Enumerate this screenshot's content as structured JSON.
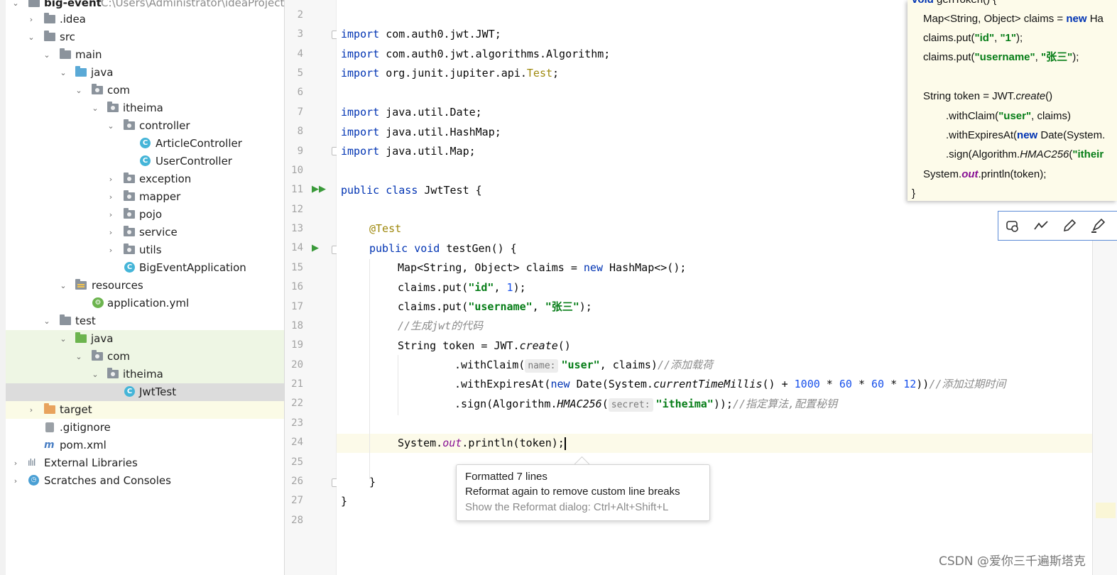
{
  "tree": {
    "root_label": "big-event",
    "root_path": "C:\\Users\\Administrator\\ideaProjects",
    "items": [
      {
        "label": ".idea"
      },
      {
        "label": "src"
      },
      {
        "label": "main"
      },
      {
        "label": "java"
      },
      {
        "label": "com"
      },
      {
        "label": "itheima"
      },
      {
        "label": "controller"
      },
      {
        "label": "ArticleController"
      },
      {
        "label": "UserController"
      },
      {
        "label": "exception"
      },
      {
        "label": "mapper"
      },
      {
        "label": "pojo"
      },
      {
        "label": "service"
      },
      {
        "label": "utils"
      },
      {
        "label": "BigEventApplication"
      },
      {
        "label": "resources"
      },
      {
        "label": "application.yml"
      },
      {
        "label": "test"
      },
      {
        "label": "java"
      },
      {
        "label": "com"
      },
      {
        "label": "itheima"
      },
      {
        "label": "JwtTest"
      },
      {
        "label": "target"
      },
      {
        "label": ".gitignore"
      },
      {
        "label": "pom.xml"
      },
      {
        "label": "External Libraries"
      },
      {
        "label": "Scratches and Consoles"
      }
    ]
  },
  "editor": {
    "line_numbers": [
      "2",
      "3",
      "4",
      "5",
      "6",
      "7",
      "8",
      "9",
      "10",
      "11",
      "12",
      "13",
      "14",
      "15",
      "16",
      "17",
      "18",
      "19",
      "20",
      "21",
      "22",
      "23",
      "24",
      "25",
      "26",
      "27",
      "28"
    ],
    "code": {
      "l3_kw": "import",
      "l3_rest": " com.auth0.jwt.JWT;",
      "l4_kw": "import",
      "l4_rest": " com.auth0.jwt.algorithms.Algorithm;",
      "l5_kw": "import",
      "l5_rest": " org.junit.jupiter.api.",
      "l5_test": "Test",
      "l5_end": ";",
      "l7_kw": "import",
      "l7_rest": " java.util.Date;",
      "l8_kw": "import",
      "l8_rest": " java.util.HashMap;",
      "l9_kw": "import",
      "l9_rest": " java.util.Map;",
      "l11_kw": "public class",
      "l11_rest": " JwtTest {",
      "l13_ann": "@Test",
      "l14_kw": "public void",
      "l14_rest": " testGen() {",
      "l15_a": "Map<String, Object> claims = ",
      "l15_kw": "new",
      "l15_b": " HashMap<>();",
      "l16_a": "claims.put(",
      "l16_s": "\"id\"",
      "l16_b": ", ",
      "l16_n": "1",
      "l16_c": ");",
      "l17_a": "claims.put(",
      "l17_s1": "\"username\"",
      "l17_b": ", ",
      "l17_s2": "\"张三\"",
      "l17_c": ");",
      "l18_cmt": "//生成jwt的代码",
      "l19_a": "String token = JWT.",
      "l19_it": "create",
      "l19_b": "()",
      "l20_a": ".withClaim(",
      "l20_hint": "name:",
      "l20_s": "\"user\"",
      "l20_b": ", claims)",
      "l20_cmt": "//添加载荷",
      "l21_a": ".withExpiresAt(",
      "l21_kw": "new",
      "l21_b": " Date(System.",
      "l21_it": "currentTimeMillis",
      "l21_c": "() + ",
      "l21_n1": "1000",
      "l21_d": " * ",
      "l21_n2": "60",
      "l21_e": " * ",
      "l21_n3": "60",
      "l21_f": " * ",
      "l21_n4": "12",
      "l21_g": "))",
      "l21_cmt": "//添加过期时间",
      "l22_a": ".sign(Algorithm.",
      "l22_it": "HMAC256",
      "l22_b": "(",
      "l22_hint": "secret:",
      "l22_s": "\"itheima\"",
      "l22_c": "));",
      "l22_cmt": "//指定算法,配置秘钥",
      "l24_a": "System.",
      "l24_fld": "out",
      "l24_b": ".println(token);",
      "l26": "}",
      "l27": "}"
    }
  },
  "overlay": {
    "lines": [
      "void genToken() {",
      "Map<String, Object> claims = new Ha",
      "claims.put(\"id\", \"1\");",
      "claims.put(\"username\", \"张三\");",
      "String token = JWT.create()",
      ".withClaim(\"user\", claims)",
      ".withExpiresAt(new Date(System.",
      ".sign(Algorithm.HMAC256(\"itheir",
      "System.out.println(token);",
      "}"
    ]
  },
  "popup": {
    "line1": "Formatted 7 lines",
    "line2": "Reformat again to remove custom line breaks",
    "line3": "Show the Reformat dialog: Ctrl+Alt+Shift+L"
  },
  "watermark": "CSDN @爱你三千遍斯塔克",
  "colors": {
    "keyword": "#0033b3",
    "string": "#067d17",
    "number": "#1750eb",
    "annotation": "#9e880d",
    "comment": "#8c8c8c"
  }
}
